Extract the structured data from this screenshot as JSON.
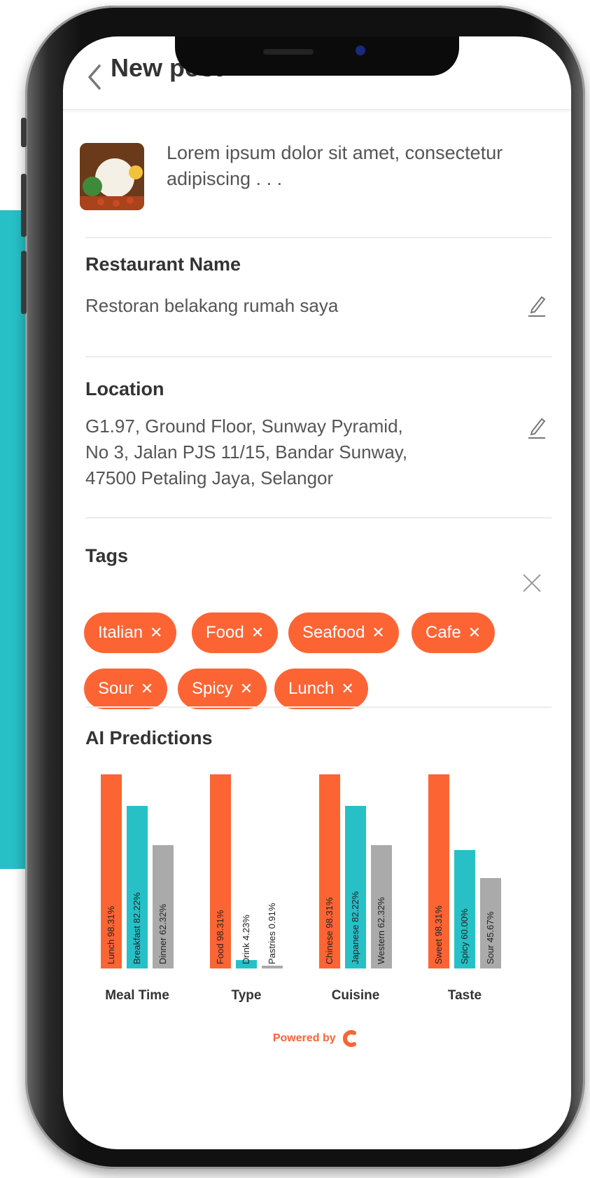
{
  "header": {
    "title": "New post"
  },
  "post": {
    "caption": "Lorem ipsum dolor sit amet, consectetur adipiscing . . ."
  },
  "restaurant": {
    "label": "Restaurant Name",
    "value": "Restoran belakang rumah saya"
  },
  "location": {
    "label": "Location",
    "lines": [
      "G1.97, Ground Floor, Sunway Pyramid,",
      "No 3, Jalan PJS 11/15, Bandar Sunway,",
      "47500 Petaling Jaya, Selangor"
    ]
  },
  "tags": {
    "label": "Tags",
    "items": [
      "Italian",
      "Food",
      "Seafood",
      "Cafe",
      "Sour",
      "Spicy",
      "Lunch"
    ]
  },
  "predictions": {
    "label": "AI Predictions"
  },
  "chart_data": {
    "type": "bar",
    "categories": [
      "Meal Time",
      "Type",
      "Cuisine",
      "Taste"
    ],
    "groups": [
      {
        "category": "Meal Time",
        "bars": [
          {
            "label": "Lunch 98.31%",
            "value": 98.31,
            "color": "#fd6434"
          },
          {
            "label": "Breakfast 82.22%",
            "value": 82.22,
            "color": "#27c0c7"
          },
          {
            "label": "Dinner 62.32%",
            "value": 62.32,
            "color": "#aaaaaa"
          }
        ]
      },
      {
        "category": "Type",
        "bars": [
          {
            "label": "Food 98.31%",
            "value": 98.31,
            "color": "#fd6434"
          },
          {
            "label": "Drink 4.23%",
            "value": 4.23,
            "color": "#27c0c7"
          },
          {
            "label": "Pastries 0.91%",
            "value": 0.91,
            "color": "#aaaaaa"
          }
        ]
      },
      {
        "category": "Cuisine",
        "bars": [
          {
            "label": "Chinese 98.31%",
            "value": 98.31,
            "color": "#fd6434"
          },
          {
            "label": "Japanese 82.22%",
            "value": 82.22,
            "color": "#27c0c7"
          },
          {
            "label": "Western 62.32%",
            "value": 62.32,
            "color": "#aaaaaa"
          }
        ]
      },
      {
        "category": "Taste",
        "bars": [
          {
            "label": "Sweet 98.31%",
            "value": 98.31,
            "color": "#fd6434"
          },
          {
            "label": "Spicy 60.00%",
            "value": 60.0,
            "color": "#27c0c7"
          },
          {
            "label": "Sour 45.67%",
            "value": 45.67,
            "color": "#aaaaaa"
          }
        ]
      }
    ],
    "ylim": [
      0,
      100
    ],
    "title": "",
    "xlabel": "",
    "ylabel": ""
  },
  "footer": {
    "powered_by": "Powered by"
  },
  "colors": {
    "accent": "#fd6434",
    "teal": "#27c0c7",
    "gray": "#aaaaaa"
  }
}
